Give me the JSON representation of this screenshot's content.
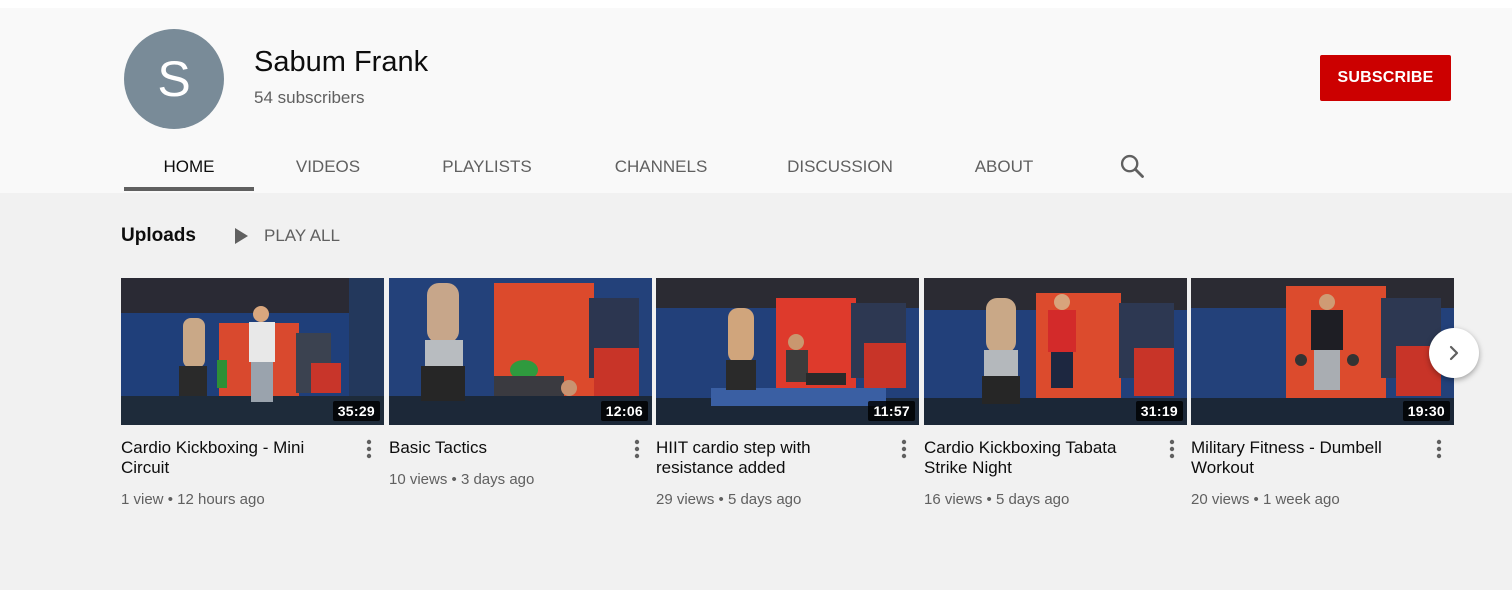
{
  "channel": {
    "avatar_letter": "S",
    "name": "Sabum Frank",
    "subscribers": "54 subscribers",
    "subscribe_label": "SUBSCRIBE"
  },
  "tabs": [
    {
      "label": "HOME",
      "active": true
    },
    {
      "label": "VIDEOS",
      "active": false
    },
    {
      "label": "PLAYLISTS",
      "active": false
    },
    {
      "label": "CHANNELS",
      "active": false
    },
    {
      "label": "DISCUSSION",
      "active": false
    },
    {
      "label": "ABOUT",
      "active": false
    }
  ],
  "uploads": {
    "title": "Uploads",
    "play_all_label": "PLAY ALL",
    "videos": [
      {
        "title": "Cardio Kickboxing - Mini Circuit",
        "duration": "35:29",
        "views": "1 view",
        "age": "12 hours ago"
      },
      {
        "title": "Basic Tactics",
        "duration": "12:06",
        "views": "10 views",
        "age": "3 days ago"
      },
      {
        "title": "HIIT cardio step with resistance added",
        "duration": "11:57",
        "views": "29 views",
        "age": "5 days ago"
      },
      {
        "title": "Cardio Kickboxing Tabata Strike Night",
        "duration": "31:19",
        "views": "16 views",
        "age": "5 days ago"
      },
      {
        "title": "Military Fitness - Dumbell Workout",
        "duration": "19:30",
        "views": "20 views",
        "age": "1 week ago"
      }
    ]
  },
  "colors": {
    "subscribe_red": "#cc0000",
    "avatar_bg": "#798b98",
    "header_bg": "#f9f9f9",
    "content_bg": "#f1f1f1",
    "secondary_text": "#606060"
  },
  "icons": {
    "search": "search-icon",
    "play": "play-icon",
    "more": "more-vert-icon",
    "next": "chevron-right-icon"
  }
}
